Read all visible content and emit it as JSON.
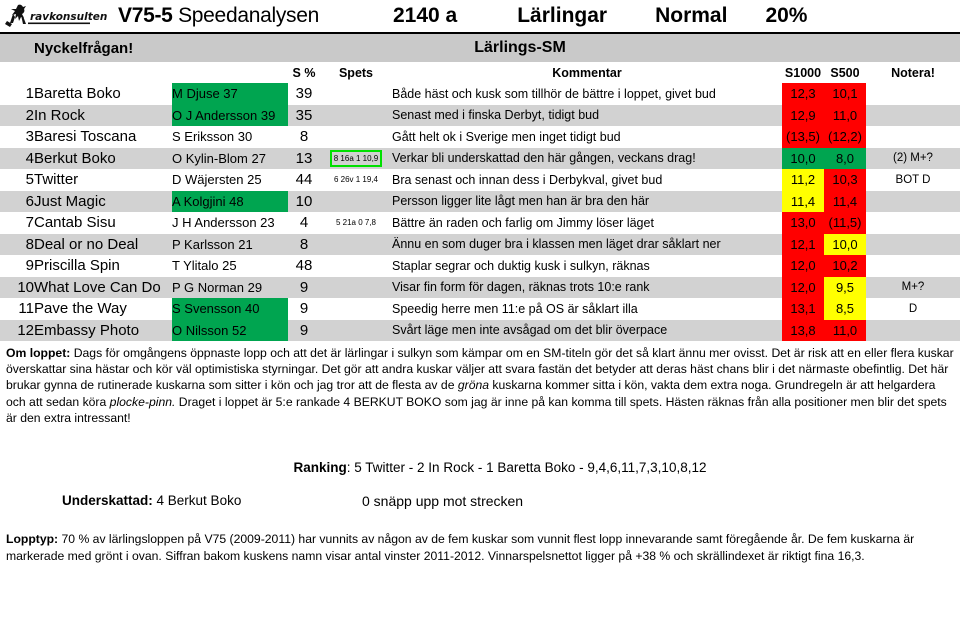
{
  "header": {
    "logo_text": "ravkonsulten",
    "race_code": "V75-5",
    "product": "Speedanalysen",
    "distance": "2140 a",
    "class": "Lärlingar",
    "pace": "Normal",
    "percent": "20%"
  },
  "subheader": {
    "key_question": "Nyckelfrågan!",
    "race_name": "Lärlings-SM"
  },
  "columns": {
    "num": "",
    "horse": "",
    "driver": "",
    "s_pct": "S %",
    "spets": "Spets",
    "kommentar": "Kommentar",
    "s1000": "S1000",
    "s500": "S500",
    "notera": "Notera!"
  },
  "rows": [
    {
      "num": "1",
      "horse": "Baretta Boko",
      "driver": "M Djuse 37",
      "driver_green": true,
      "s_pct": "39",
      "spets": "",
      "spets_box": false,
      "kommentar": "Både häst och kusk som tillhör de bättre i loppet, givet bud",
      "s1000": "12,3",
      "s1000_color": "red",
      "s500": "10,1",
      "s500_color": "red",
      "notera": "",
      "alt": false
    },
    {
      "num": "2",
      "horse": "In Rock",
      "driver": "O J Andersson 39",
      "driver_green": true,
      "s_pct": "35",
      "spets": "",
      "spets_box": false,
      "kommentar": "Senast med i finska Derbyt, tidigt bud",
      "s1000": "12,9",
      "s1000_color": "red",
      "s500": "11,0",
      "s500_color": "red",
      "notera": "",
      "alt": true
    },
    {
      "num": "3",
      "horse": "Baresi Toscana",
      "driver": "S Eriksson 30",
      "driver_green": false,
      "s_pct": "8",
      "spets": "",
      "spets_box": false,
      "kommentar": "Gått helt ok i Sverige men inget tidigt bud",
      "s1000": "(13,5)",
      "s1000_color": "red",
      "s500": "(12,2)",
      "s500_color": "red",
      "notera": "",
      "alt": false
    },
    {
      "num": "4",
      "horse": "Berkut Boko",
      "driver": "O Kylin-Blom 27",
      "driver_green": false,
      "s_pct": "13",
      "spets": "8 16a 1 10,9",
      "spets_box": true,
      "kommentar": "Verkar bli underskattad den här gången, veckans drag!",
      "s1000": "10,0",
      "s1000_color": "green",
      "s500": "8,0",
      "s500_color": "green",
      "notera": "(2) M+?",
      "alt": true
    },
    {
      "num": "5",
      "horse": "Twitter",
      "driver": "D Wäjersten 25",
      "driver_green": false,
      "s_pct": "44",
      "spets": "6 26v 1 19,4",
      "spets_box": false,
      "kommentar": "Bra senast och innan dess i Derbykval, givet bud",
      "s1000": "11,2",
      "s1000_color": "yellow",
      "s500": "10,3",
      "s500_color": "red",
      "notera": "BOT D",
      "alt": false
    },
    {
      "num": "6",
      "horse": "Just Magic",
      "driver": "A Kolgjini 48",
      "driver_green": true,
      "s_pct": "10",
      "spets": "",
      "spets_box": false,
      "kommentar": "Persson ligger lite lågt men han är bra den här",
      "s1000": "11,4",
      "s1000_color": "yellow",
      "s500": "11,4",
      "s500_color": "red",
      "notera": "",
      "alt": true
    },
    {
      "num": "7",
      "horse": "Cantab Sisu",
      "driver": "J H Andersson 23",
      "driver_green": false,
      "s_pct": "4",
      "spets": "5 21a 0  7,8",
      "spets_box": false,
      "kommentar": "Bättre än raden och farlig om Jimmy löser läget",
      "s1000": "13,0",
      "s1000_color": "red",
      "s500": "(11,5)",
      "s500_color": "red",
      "notera": "",
      "alt": false
    },
    {
      "num": "8",
      "horse": "Deal or no Deal",
      "driver": "P Karlsson 21",
      "driver_green": false,
      "s_pct": "8",
      "spets": "",
      "spets_box": false,
      "kommentar": "Ännu en som duger bra i klassen men läget drar såklart ner",
      "s1000": "12,1",
      "s1000_color": "red",
      "s500": "10,0",
      "s500_color": "yellow",
      "notera": "",
      "alt": true
    },
    {
      "num": "9",
      "horse": "Priscilla Spin",
      "driver": "T Ylitalo 25",
      "driver_green": false,
      "s_pct": "48",
      "spets": "",
      "spets_box": false,
      "kommentar": "Staplar segrar och duktig kusk i sulkyn, räknas",
      "s1000": "12,0",
      "s1000_color": "red",
      "s500": "10,2",
      "s500_color": "red",
      "notera": "",
      "alt": false
    },
    {
      "num": "10",
      "horse": "What Love Can Do",
      "driver": "P G Norman 29",
      "driver_green": false,
      "s_pct": "9",
      "spets": "",
      "spets_box": false,
      "kommentar": "Visar fin form för dagen, räknas trots 10:e rank",
      "s1000": "12,0",
      "s1000_color": "red",
      "s500": "9,5",
      "s500_color": "yellow",
      "notera": "M+?",
      "alt": true
    },
    {
      "num": "11",
      "horse": "Pave the Way",
      "driver": "S Svensson 40",
      "driver_green": true,
      "s_pct": "9",
      "spets": "",
      "spets_box": false,
      "kommentar": "Speedig herre men 11:e på OS är såklart illa",
      "s1000": "13,1",
      "s1000_color": "red",
      "s500": "8,5",
      "s500_color": "yellow",
      "notera": "D",
      "alt": false
    },
    {
      "num": "12",
      "horse": "Embassy Photo",
      "driver": "O Nilsson 52",
      "driver_green": true,
      "s_pct": "9",
      "spets": "",
      "spets_box": false,
      "kommentar": "Svårt läge men inte avsågad om det blir överpace",
      "s1000": "13,8",
      "s1000_color": "red",
      "s500": "11,0",
      "s500_color": "red",
      "notera": "",
      "alt": true
    }
  ],
  "about": {
    "label": "Om loppet:",
    "part1": " Dags för omgångens öppnaste lopp och att det är lärlingar i sulkyn som kämpar om en SM-titeln gör det så klart ännu mer ovisst. Det är risk att en eller flera kuskar överskattar sina hästar och kör väl optimistiska styrningar. Det gör att andra kuskar väljer att svara fastän det betyder att deras häst chans blir i det närmaste obefintlig. Det här brukar gynna de rutinerade kuskarna som sitter i kön och jag tror att de flesta av de ",
    "italic1": "gröna",
    "part2": " kuskarna kommer sitta i kön, vakta dem extra noga. Grundregeln är att helgardera och att sedan köra ",
    "italic2": "plocke-pinn.",
    "part3": "  Draget i loppet är 5:e rankade 4 BERKUT BOKO som jag är inne på kan komma till spets. Hästen räknas från alla positioner men blir det spets är den extra intressant!"
  },
  "ranking": {
    "label": "Ranking",
    "value": ": 5 Twitter - 2 In Rock - 1 Baretta Boko - 9,4,6,11,7,3,10,8,12"
  },
  "underskattad": {
    "label": "Underskattad:",
    "value": " 4 Berkut Boko",
    "note": "0 snäpp upp mot strecken"
  },
  "lopptyp": {
    "label": "Lopptyp:",
    "text": " 70 % av lärlingsloppen på V75 (2009-2011) har vunnits av någon av de fem kuskar som vunnit flest lopp innevarande samt föregående år. De fem kuskarna är markerade med grönt i ovan. Siffran bakom kuskens namn visar antal vinster 2011-2012. Vinnarspelsnettot ligger på +38 % och skrällindexet är riktigt fina 16,3."
  },
  "colors": {
    "green": "#00a550",
    "red": "#ff0000",
    "yellow": "#ffff00",
    "grey_row": "#d2d2d2",
    "grey_header": "#c9c9c9"
  }
}
